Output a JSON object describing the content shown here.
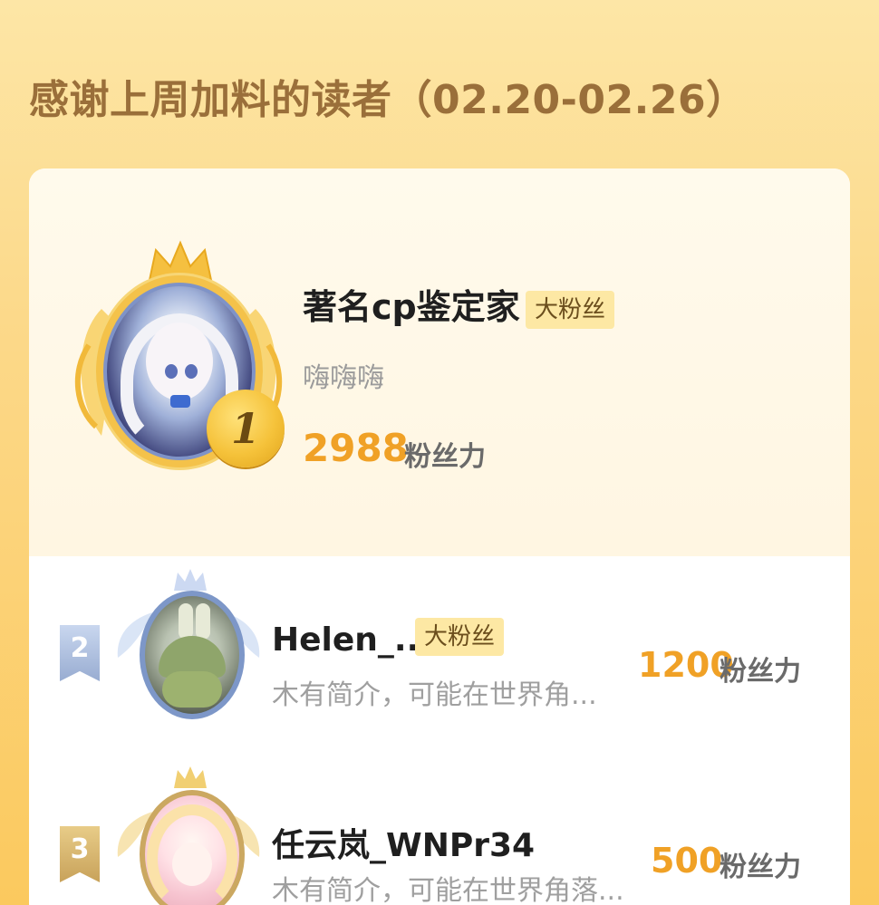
{
  "header": {
    "title": "感谢上周加料的读者（02.20-02.26）"
  },
  "leaderboard": [
    {
      "rank": "1",
      "name": "著名cp鉴定家",
      "badge": "大粉丝",
      "bio": "嗨嗨嗨",
      "score": "2988",
      "unit": "粉丝力"
    },
    {
      "rank": "2",
      "name": "Helen_...",
      "badge": "大粉丝",
      "bio": "木有简介，可能在世界角...",
      "score": "1200",
      "unit": "粉丝力"
    },
    {
      "rank": "3",
      "name": "任云岚_WNPr34",
      "badge": "",
      "bio": "木有简介，可能在世界角落...",
      "score": "500",
      "unit": "粉丝力"
    }
  ],
  "colors": {
    "accent_score": "#f0a126",
    "badge_bg": "#fde8a4",
    "gold": "#f4c24a",
    "silver": "#98acd1",
    "bronze": "#c8a25a"
  }
}
